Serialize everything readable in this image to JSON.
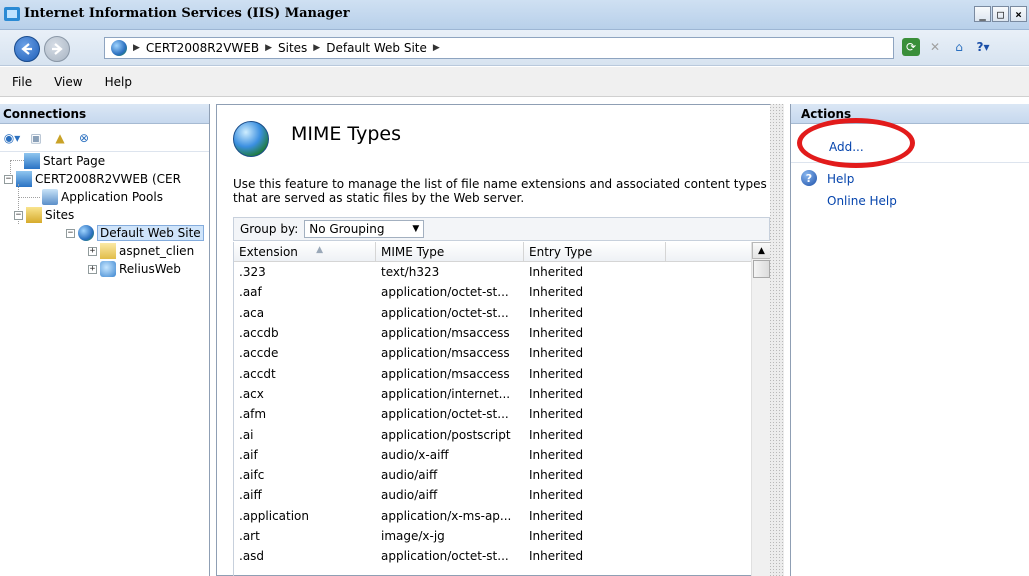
{
  "window": {
    "title": "Internet Information Services (IIS) Manager",
    "controls": [
      "_",
      "□",
      "×"
    ]
  },
  "address": {
    "crumbs": [
      "CERT2008R2VWEB",
      "Sites",
      "Default Web Site"
    ]
  },
  "menu": {
    "items": [
      "File",
      "View",
      "Help"
    ]
  },
  "connections": {
    "title": "Connections",
    "tree": {
      "start_page": "Start Page",
      "server": "CERT2008R2VWEB (CER",
      "app_pools": "Application Pools",
      "sites": "Sites",
      "default_site": "Default Web Site",
      "aspnet": "aspnet_clien",
      "relius": "ReliusWeb"
    }
  },
  "feature": {
    "title": "MIME Types",
    "description": "Use this feature to manage the list of file name extensions and associated content types that are served as static files by the Web server.",
    "group_by_label": "Group by:",
    "group_by_value": "No Grouping"
  },
  "table": {
    "columns": [
      "Extension",
      "MIME Type",
      "Entry Type"
    ],
    "rows": [
      [
        ".323",
        "text/h323",
        "Inherited"
      ],
      [
        ".aaf",
        "application/octet-st...",
        "Inherited"
      ],
      [
        ".aca",
        "application/octet-st...",
        "Inherited"
      ],
      [
        ".accdb",
        "application/msaccess",
        "Inherited"
      ],
      [
        ".accde",
        "application/msaccess",
        "Inherited"
      ],
      [
        ".accdt",
        "application/msaccess",
        "Inherited"
      ],
      [
        ".acx",
        "application/internet...",
        "Inherited"
      ],
      [
        ".afm",
        "application/octet-st...",
        "Inherited"
      ],
      [
        ".ai",
        "application/postscript",
        "Inherited"
      ],
      [
        ".aif",
        "audio/x-aiff",
        "Inherited"
      ],
      [
        ".aifc",
        "audio/aiff",
        "Inherited"
      ],
      [
        ".aiff",
        "audio/aiff",
        "Inherited"
      ],
      [
        ".application",
        "application/x-ms-ap...",
        "Inherited"
      ],
      [
        ".art",
        "image/x-jg",
        "Inherited"
      ],
      [
        ".asd",
        "application/octet-st...",
        "Inherited"
      ]
    ]
  },
  "actions": {
    "title": "Actions",
    "add": "Add...",
    "help": "Help",
    "online_help": "Online Help"
  },
  "colors": {
    "highlight_ellipse": "#e21b1b",
    "link": "#0645ad"
  }
}
